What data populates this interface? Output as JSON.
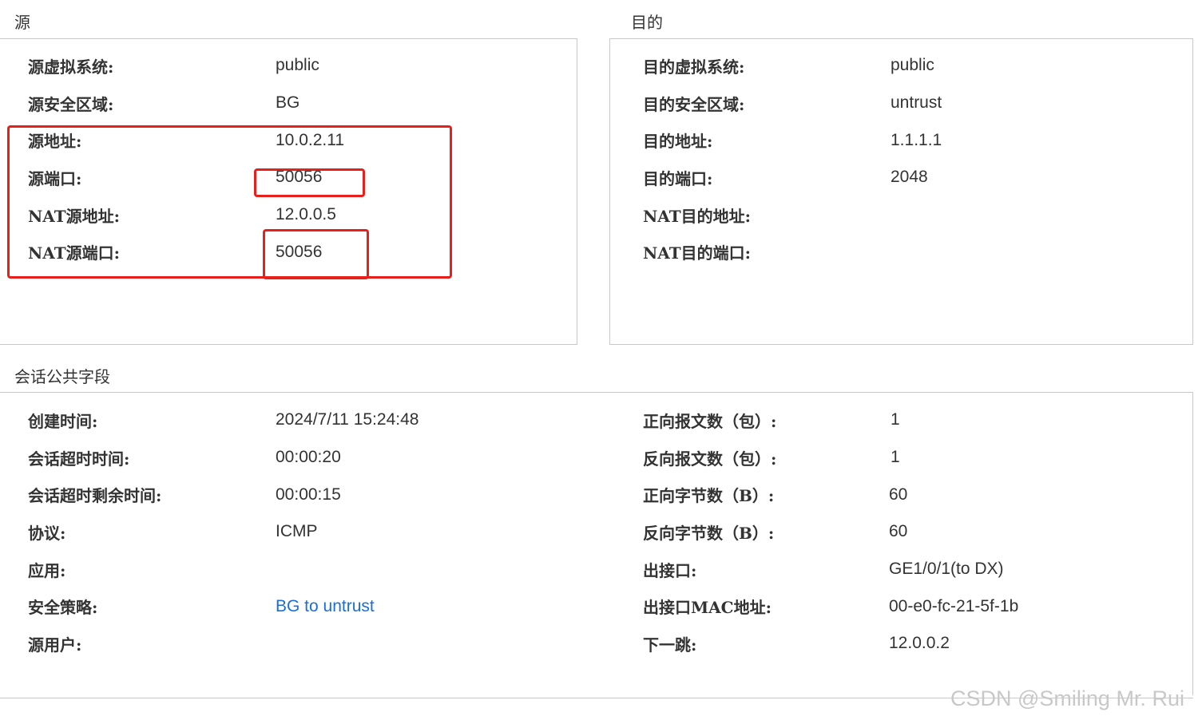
{
  "source": {
    "title": "源",
    "rows": [
      {
        "label": "源虚拟系统:",
        "value": "public"
      },
      {
        "label": "源安全区域:",
        "value": "BG"
      },
      {
        "label": "源地址:",
        "value": "10.0.2.11"
      },
      {
        "label": "源端口:",
        "value": "50056"
      },
      {
        "label": "NAT源地址:",
        "value": "12.0.0.5"
      },
      {
        "label": "NAT源端口:",
        "value": "50056"
      }
    ]
  },
  "destination": {
    "title": "目的",
    "rows": [
      {
        "label": "目的虚拟系统:",
        "value": "public"
      },
      {
        "label": "目的安全区域:",
        "value": "untrust"
      },
      {
        "label": "目的地址:",
        "value": "1.1.1.1"
      },
      {
        "label": "目的端口:",
        "value": "2048"
      },
      {
        "label": "NAT目的地址:",
        "value": ""
      },
      {
        "label": "NAT目的端口:",
        "value": ""
      }
    ]
  },
  "session": {
    "title": "会话公共字段",
    "left": [
      {
        "label": "创建时间:",
        "value": "2024/7/11 15:24:48"
      },
      {
        "label": "会话超时时间:",
        "value": "00:00:20"
      },
      {
        "label": "会话超时剩余时间:",
        "value": "00:00:15"
      },
      {
        "label": "协议:",
        "value": "ICMP"
      },
      {
        "label": "应用:",
        "value": ""
      },
      {
        "label": "安全策略:",
        "value": "BG to untrust"
      },
      {
        "label": "源用户:",
        "value": ""
      }
    ],
    "right": [
      {
        "label": "正向报文数（包）:",
        "value": "1"
      },
      {
        "label": "反向报文数（包）:",
        "value": "1"
      },
      {
        "label": "正向字节数（B）:",
        "value": "60"
      },
      {
        "label": "反向字节数（B）:",
        "value": "60"
      },
      {
        "label": "出接口:",
        "value": "GE1/0/1(to DX)"
      },
      {
        "label": "出接口MAC地址:",
        "value": "00-e0-fc-21-5f-1b"
      },
      {
        "label": "下一跳:",
        "value": "12.0.0.2"
      }
    ]
  },
  "watermark": "CSDN @Smiling Mr. Rui",
  "colors": {
    "annotation": "#e8201c",
    "link": "#1a6fd6"
  }
}
